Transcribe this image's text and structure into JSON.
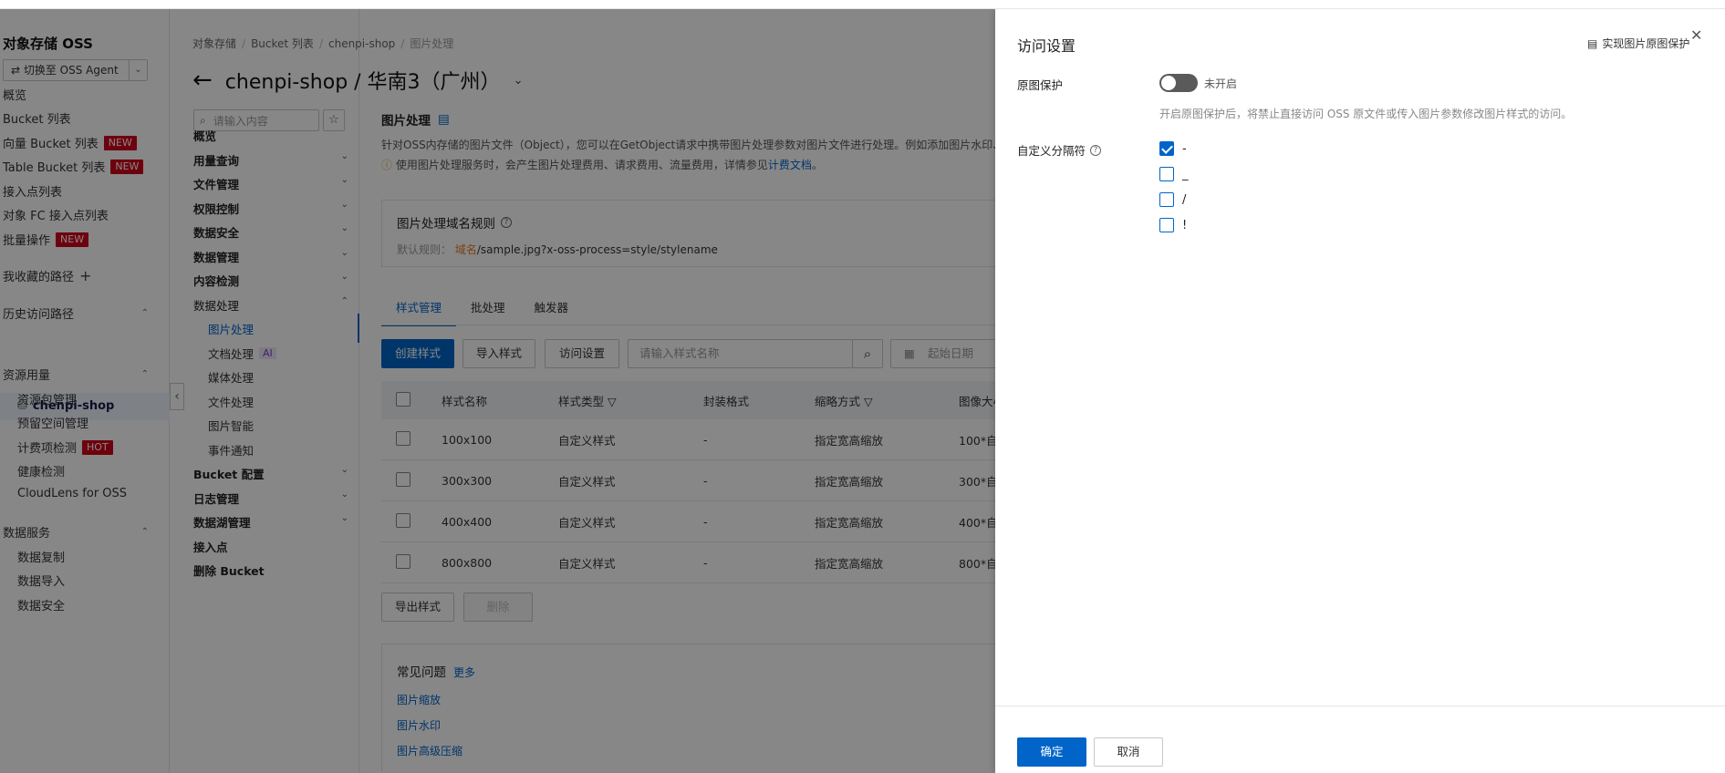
{
  "global_sidebar": {
    "title": "对象存储 OSS",
    "switch_label": "⇄ 切换至 OSS Agent",
    "items": [
      {
        "label": "概览"
      },
      {
        "label": "Bucket 列表"
      },
      {
        "label": "向量 Bucket 列表",
        "badge": "NEW"
      },
      {
        "label": "Table Bucket 列表",
        "badge": "NEW"
      },
      {
        "label": "接入点列表"
      },
      {
        "label": "对象 FC 接入点列表"
      },
      {
        "label": "批量操作",
        "badge": "NEW"
      }
    ],
    "favorites_label": "我收藏的路径",
    "history_label": "历史访问路径",
    "history_item": "chenpi-shop",
    "resource_label": "资源用量",
    "resource_items": [
      {
        "label": "资源包管理"
      },
      {
        "label": "预留空间管理"
      },
      {
        "label": "计费项检测",
        "badge": "HOT"
      },
      {
        "label": "健康检测"
      },
      {
        "label": "CloudLens for OSS"
      }
    ],
    "data_service_label": "数据服务",
    "data_service_items": [
      {
        "label": "数据复制"
      },
      {
        "label": "数据导入"
      },
      {
        "label": "数据安全"
      }
    ]
  },
  "second_sidebar": {
    "search_placeholder": "请输入内容",
    "items": [
      {
        "label": "概览",
        "chevron": ""
      },
      {
        "label": "用量查询",
        "chevron": "⌄"
      },
      {
        "label": "文件管理",
        "chevron": "⌄"
      },
      {
        "label": "权限控制",
        "chevron": "⌄"
      },
      {
        "label": "数据安全",
        "chevron": "⌄"
      },
      {
        "label": "数据管理",
        "chevron": "⌄"
      },
      {
        "label": "内容检测",
        "chevron": "⌄"
      },
      {
        "label": "数据处理",
        "chevron": "⌃"
      }
    ],
    "sub_items": [
      {
        "label": "图片处理"
      },
      {
        "label": "文档处理",
        "badge": "AI"
      },
      {
        "label": "媒体处理"
      },
      {
        "label": "文件处理"
      },
      {
        "label": "图片智能"
      },
      {
        "label": "事件通知"
      }
    ],
    "bottom_items": [
      {
        "label": "Bucket 配置",
        "chevron": "⌄"
      },
      {
        "label": "日志管理",
        "chevron": "⌄"
      },
      {
        "label": "数据湖管理",
        "chevron": "⌄"
      },
      {
        "label": "接入点",
        "chevron": ""
      },
      {
        "label": "删除 Bucket",
        "chevron": ""
      }
    ]
  },
  "main": {
    "breadcrumb": [
      "对象存储",
      "Bucket 列表",
      "chenpi-shop",
      "图片处理"
    ],
    "title": "chenpi-shop / 华南3（广州）",
    "section_title": "图片处理",
    "desc1": "针对OSS内存储的图片文件（Object），您可以在GetObject请求中携带图片处理参数对图片文件进行处理。例如添加图片水印、",
    "desc2_prefix": "使用图片处理服务时，会产生图片处理费用、请求费用、流量费用，详情参见",
    "desc2_link": "计费文档",
    "desc2_suffix": "。",
    "rule_title": "图片处理域名规则",
    "rule_default_label": "默认规则：",
    "rule_domain": "域名",
    "rule_path": "/sample.jpg?x-oss-process=style/stylename",
    "tabs": [
      "样式管理",
      "批处理",
      "触发器"
    ],
    "btn_create": "创建样式",
    "btn_import": "导入样式",
    "btn_access": "访问设置",
    "search_placeholder": "请输入样式名称",
    "date_placeholder": "起始日期",
    "table": {
      "headers": [
        "样式名称",
        "样式类型",
        "封装格式",
        "缩略方式",
        "图像大小"
      ],
      "rows": [
        {
          "name": "100x100",
          "type": "自定义样式",
          "format": "-",
          "mode": "指定宽高缩放",
          "size": "100*自"
        },
        {
          "name": "300x300",
          "type": "自定义样式",
          "format": "-",
          "mode": "指定宽高缩放",
          "size": "300*自"
        },
        {
          "name": "400x400",
          "type": "自定义样式",
          "format": "-",
          "mode": "指定宽高缩放",
          "size": "400*自"
        },
        {
          "name": "800x800",
          "type": "自定义样式",
          "format": "-",
          "mode": "指定宽高缩放",
          "size": "800*自"
        }
      ]
    },
    "btn_export": "导出样式",
    "btn_delete": "删除",
    "faq_title": "常见问题",
    "faq_more": "更多",
    "faq_links": [
      "图片缩放",
      "图片水印",
      "图片高级压缩"
    ]
  },
  "drawer": {
    "title": "访问设置",
    "link": "实现图片原图保护",
    "protect_label": "原图保护",
    "toggle_state": "未开启",
    "toggle_on": false,
    "hint": "开启原图保护后，将禁止直接访问 OSS 原文件或传入图片参数修改图片样式的访问。",
    "separator_label": "自定义分隔符",
    "separators": [
      {
        "symbol": "-",
        "checked": true
      },
      {
        "symbol": "_",
        "checked": false
      },
      {
        "symbol": "/",
        "checked": false
      },
      {
        "symbol": "!",
        "checked": false
      }
    ],
    "ok": "确定",
    "cancel": "取消"
  },
  "colors": {
    "primary": "#0064c8",
    "badge_red": "#d0021b",
    "overlay": "rgba(0,0,0,0.47)"
  }
}
